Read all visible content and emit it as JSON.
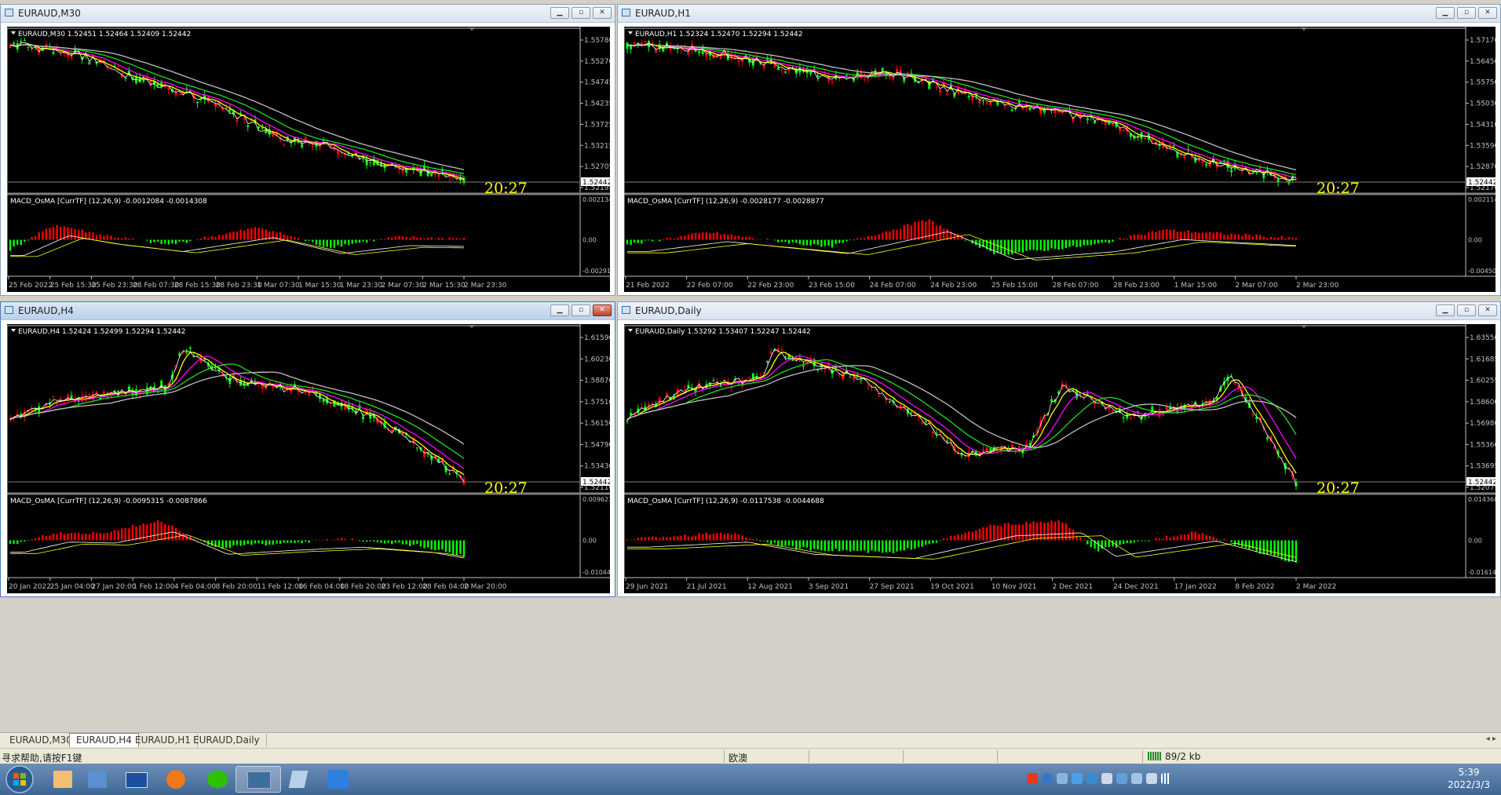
{
  "windows": [
    {
      "title": "EURAUD,M30",
      "info": "EURAUD,M30  1.52451 1.52464 1.52409 1.52442",
      "macd": "MACD_OsMA [CurrTF] (12,26,9) -0.0012084 -0.0014308",
      "price_scale": [
        "1.55780",
        "1.55270",
        "1.54745",
        "1.54235",
        "1.53725",
        "1.53215",
        "1.52705",
        "1.52195"
      ],
      "current_price": "1.52442",
      "macd_scale": [
        "0.0021344",
        "0.00",
        "-0.0029170"
      ],
      "time": "20:27",
      "dates": [
        "25 Feb 2022",
        "25 Feb 15:30",
        "25 Feb 23:30",
        "28 Feb 07:30",
        "28 Feb 15:30",
        "28 Feb 23:30",
        "1 Mar 07:30",
        "1 Mar 15:30",
        "1 Mar 23:30",
        "2 Mar 07:30",
        "2 Mar 15:30",
        "2 Mar 23:30"
      ]
    },
    {
      "title": "EURAUD,H1",
      "info": "EURAUD,H1  1.52324 1.52470 1.52294 1.52442",
      "macd": "MACD_OsMA [CurrTF] (12,26,9) -0.0028177 -0.0028877",
      "price_scale": [
        "1.57170",
        "1.56450",
        "1.55750",
        "1.55030",
        "1.54310",
        "1.53590",
        "1.52870",
        "1.52170"
      ],
      "current_price": "1.52442",
      "macd_scale": [
        "0.0021148",
        "0.00",
        "-0.0045000"
      ],
      "time": "20:27",
      "dates": [
        "21 Feb 2022",
        "22 Feb 07:00",
        "22 Feb 23:00",
        "23 Feb 15:00",
        "24 Feb 07:00",
        "24 Feb 23:00",
        "25 Feb 15:00",
        "28 Feb 07:00",
        "28 Feb 23:00",
        "1 Mar 15:00",
        "2 Mar 07:00",
        "2 Mar 23:00"
      ]
    },
    {
      "title": "EURAUD,H4",
      "info": "EURAUD,H4  1.52424 1.52499 1.52294 1.52442",
      "macd": "MACD_OsMA [CurrTF] (12,26,9) -0.0095315 -0.0087866",
      "price_scale": [
        "1.61590",
        "1.60230",
        "1.58870",
        "1.57510",
        "1.56150",
        "1.54790",
        "1.53430",
        "1.52110"
      ],
      "current_price": "1.52442",
      "macd_scale": [
        "0.0096239",
        "0.00",
        "-0.0104434"
      ],
      "time": "20:27",
      "dates": [
        "20 Jan 2022",
        "25 Jan 04:00",
        "27 Jan 20:00",
        "1 Feb 12:00",
        "4 Feb 04:00",
        "8 Feb 20:00",
        "11 Feb 12:00",
        "16 Feb 04:00",
        "18 Feb 20:00",
        "23 Feb 12:00",
        "28 Feb 04:00",
        "2 Mar 20:00"
      ]
    },
    {
      "title": "EURAUD,Daily",
      "info": "EURAUD,Daily  1.53292 1.53407 1.52247 1.52442",
      "macd": "MACD_OsMA [CurrTF] (12,26,9) -0.0117538 -0.0044688",
      "price_scale": [
        "1.63550",
        "1.61685",
        "1.60255",
        "1.58600",
        "1.56980",
        "1.55360",
        "1.53695",
        "1.52075"
      ],
      "current_price": "1.52442",
      "macd_scale": [
        "0.0143607",
        "0.00",
        "-0.0161440"
      ],
      "time": "20:27",
      "dates": [
        "29 Jun 2021",
        "21 Jul 2021",
        "12 Aug 2021",
        "3 Sep 2021",
        "27 Sep 2021",
        "19 Oct 2021",
        "10 Nov 2021",
        "2 Dec 2021",
        "24 Dec 2021",
        "17 Jan 2022",
        "8 Feb 2022",
        "2 Mar 2022"
      ]
    }
  ],
  "tabs": [
    "EURAUD,M30",
    "EURAUD,H4",
    "EURAUD,H1",
    "EURAUD,Daily"
  ],
  "active_tab": 1,
  "status": {
    "help": "寻求帮助,请按F1键",
    "profile": "欧澳",
    "traffic": "89/2 kb"
  },
  "clock": {
    "time": "5:39",
    "date": "2022/3/3"
  },
  "colors": {
    "bull": "#00ff00",
    "bear": "#ff0000",
    "ma_yellow": "#ffff00",
    "ma_magenta": "#ff00ff",
    "ma_green": "#22dd22",
    "ma_gray": "#c0c0c0",
    "macd_pos": "#ff0000",
    "macd_neg": "#00ff00"
  }
}
